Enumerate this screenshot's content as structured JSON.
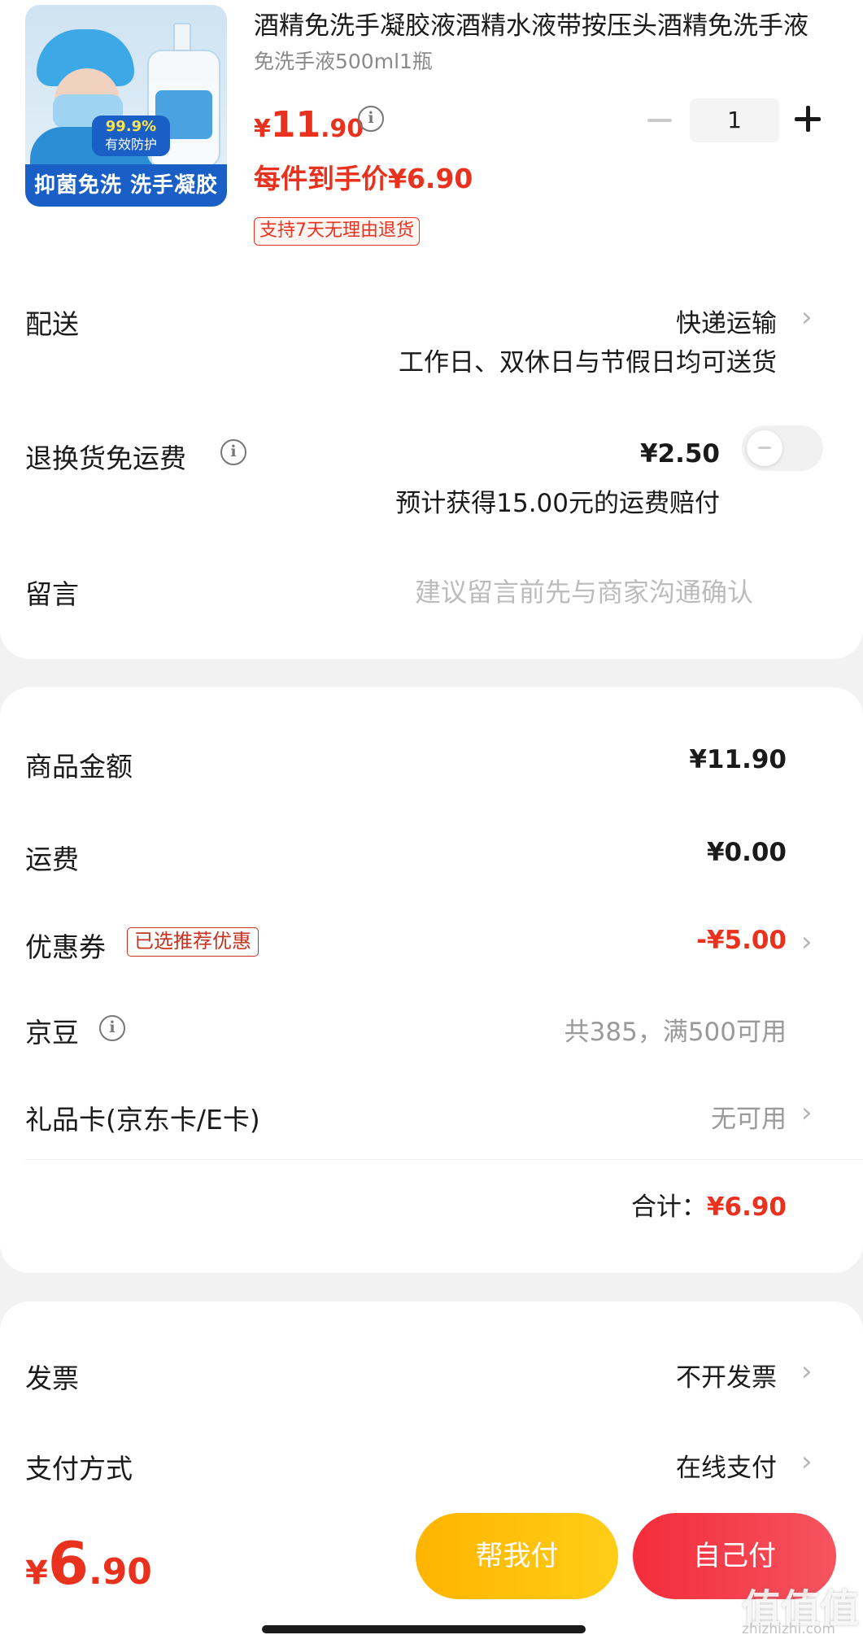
{
  "product": {
    "title": "酒精免洗手凝胶液酒精水液带按压头酒精免洗手液",
    "spec": "免洗手液500ml1瓶",
    "price_cur": "¥",
    "price_int": "11",
    "price_dec": ".90",
    "net_price": "每件到手价¥6.90",
    "return_tag": "支持7天无理由退货",
    "quantity": "1",
    "image_banner": "抑菌免洗 洗手凝胶",
    "image_promo_pct": "99.9%",
    "image_promo_text": "有效防护"
  },
  "delivery": {
    "label": "配送",
    "method": "快递运输",
    "note": "工作日、双休日与节假日均可送货"
  },
  "return_shipping": {
    "label": "退换货免运费",
    "price": "¥2.50",
    "note": "预计获得15.00元的运费赔付",
    "enabled": false
  },
  "message": {
    "label": "留言",
    "placeholder": "建议留言前先与商家沟通确认"
  },
  "summary": {
    "goods_label": "商品金额",
    "goods_value": "¥11.90",
    "freight_label": "运费",
    "freight_value": "¥0.00",
    "coupon_label": "优惠券",
    "coupon_badge": "已选推荐优惠",
    "coupon_value": "-¥5.00",
    "beans_label": "京豆",
    "beans_value": "共385，满500可用",
    "giftcard_label": "礼品卡(京东卡/E卡)",
    "giftcard_value": "无可用",
    "total_label": "合计：",
    "total_value": "¥6.90"
  },
  "invoice": {
    "label": "发票",
    "value": "不开发票"
  },
  "payment": {
    "label": "支付方式",
    "value": "在线支付"
  },
  "bottom": {
    "cur": "¥",
    "int": "6",
    "dec": ".90",
    "help_pay": "帮我付",
    "self_pay": "自己付"
  },
  "watermark": {
    "text": "值值值",
    "url": "zhizhizhi.com"
  },
  "colors": {
    "accent": "#e8321e",
    "help_btn": "#ffbf10",
    "self_btn": "#f53e4a"
  }
}
